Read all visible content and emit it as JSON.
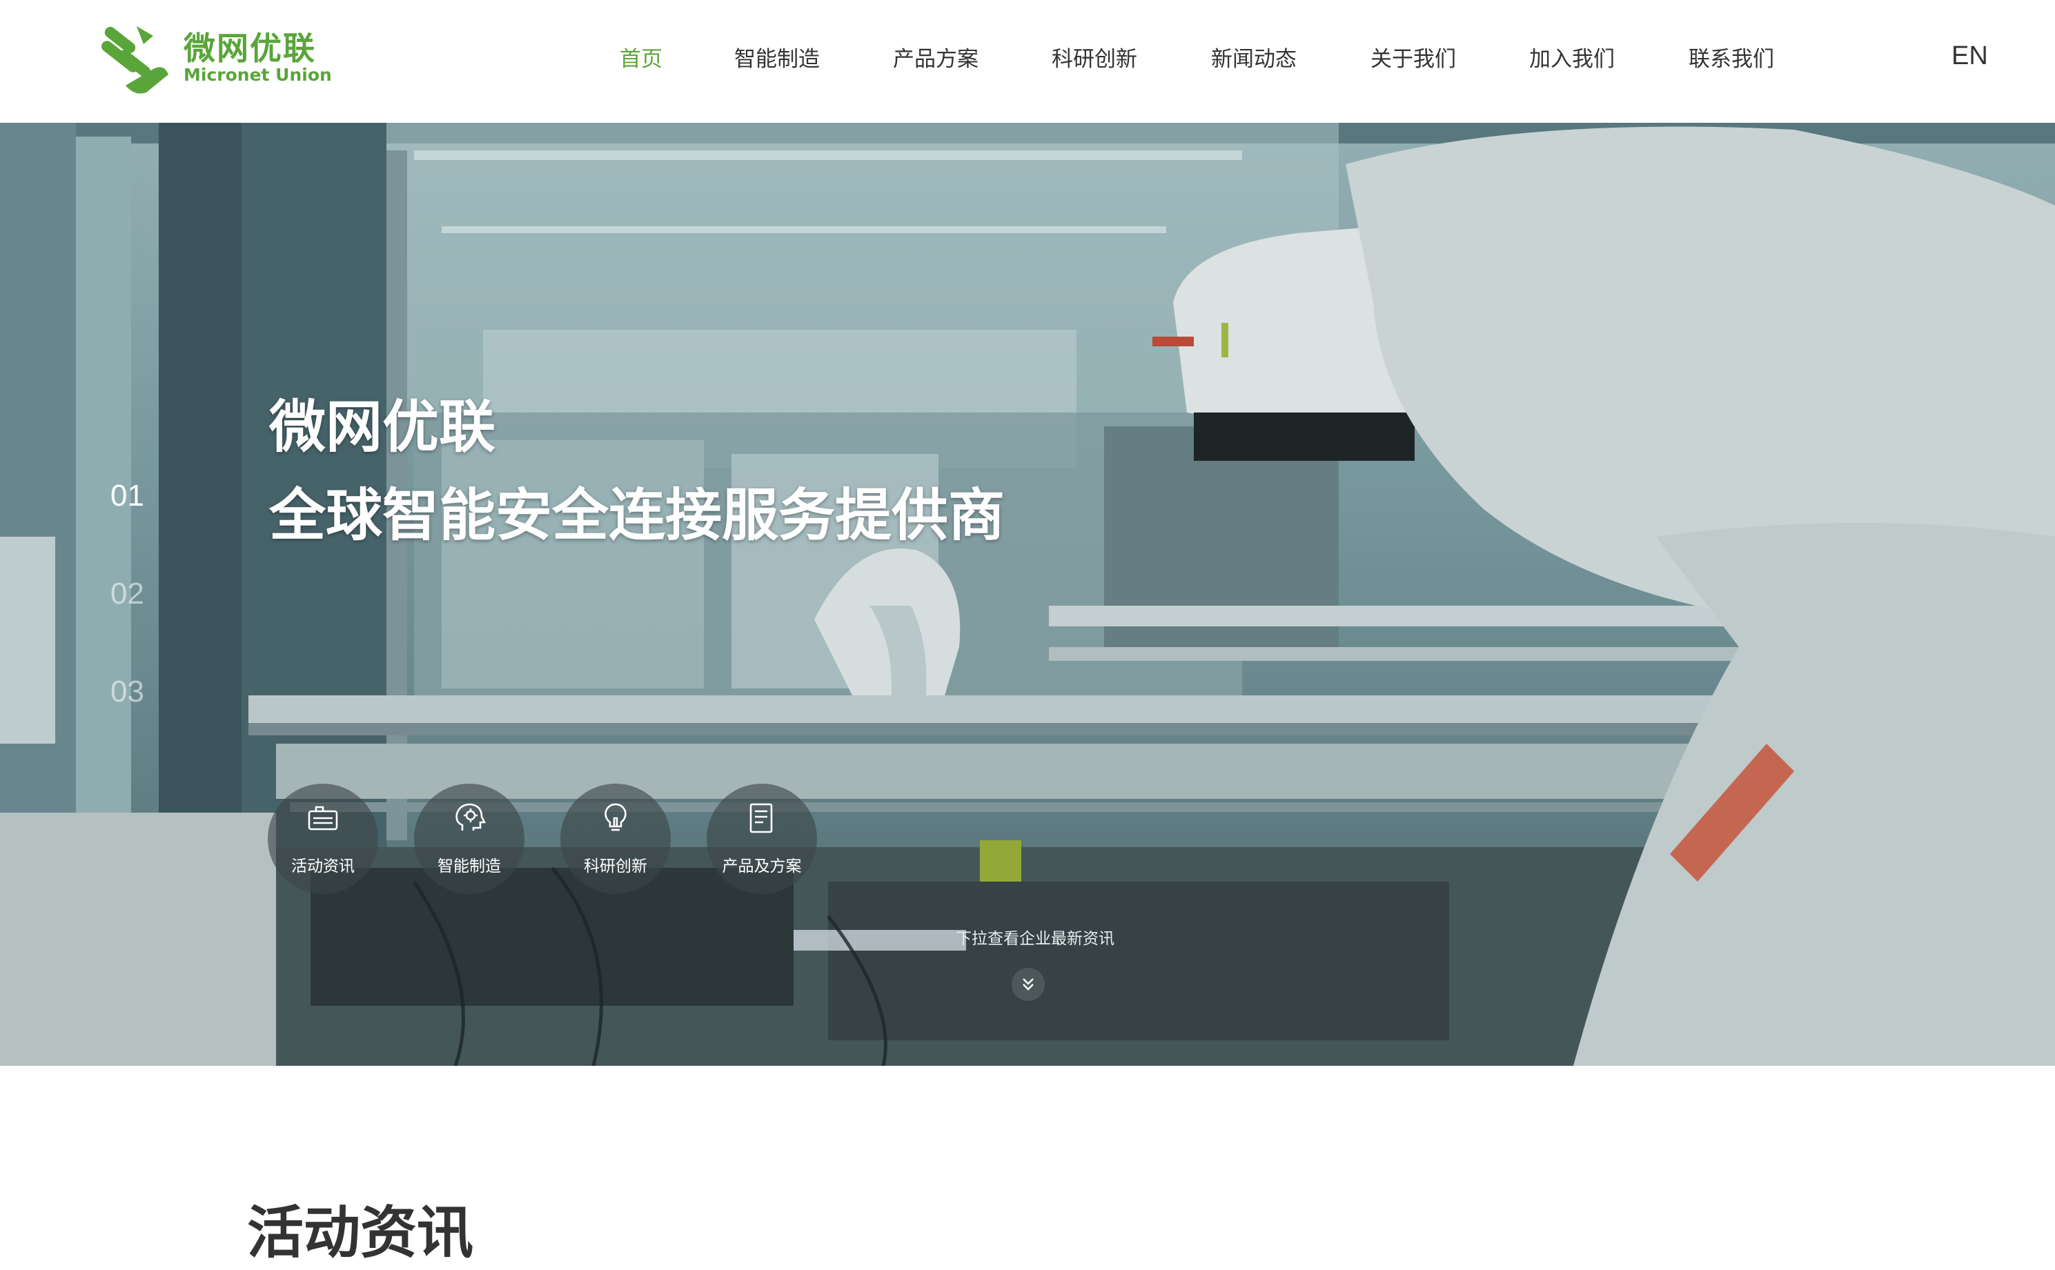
{
  "brand": {
    "name_cn": "微网优联",
    "name_en": "Micronet Union",
    "color": "#5aa53a",
    "logo_icon": "micronet-union-logo"
  },
  "nav": {
    "items": [
      {
        "label": "首页",
        "active": true
      },
      {
        "label": "智能制造",
        "active": false
      },
      {
        "label": "产品方案",
        "active": false
      },
      {
        "label": "科研创新",
        "active": false
      },
      {
        "label": "新闻动态",
        "active": false
      },
      {
        "label": "关于我们",
        "active": false
      },
      {
        "label": "加入我们",
        "active": false
      },
      {
        "label": "联系我们",
        "active": false
      }
    ],
    "lang_label": "EN"
  },
  "hero": {
    "title_line1": "微网优联",
    "title_line2": "全球智能安全连接服务提供商",
    "slides": [
      "01",
      "02",
      "03"
    ],
    "active_slide": "01",
    "quick_links": [
      {
        "label": "活动资讯",
        "icon": "newspaper-icon"
      },
      {
        "label": "智能制造",
        "icon": "brain-gear-icon"
      },
      {
        "label": "科研创新",
        "icon": "lightbulb-icon"
      },
      {
        "label": "产品及方案",
        "icon": "document-icon"
      }
    ],
    "scroll_hint": "下拉查看企业最新资讯",
    "scroll_icon": "double-chevron-down-icon"
  },
  "section": {
    "title": "活动资讯"
  }
}
